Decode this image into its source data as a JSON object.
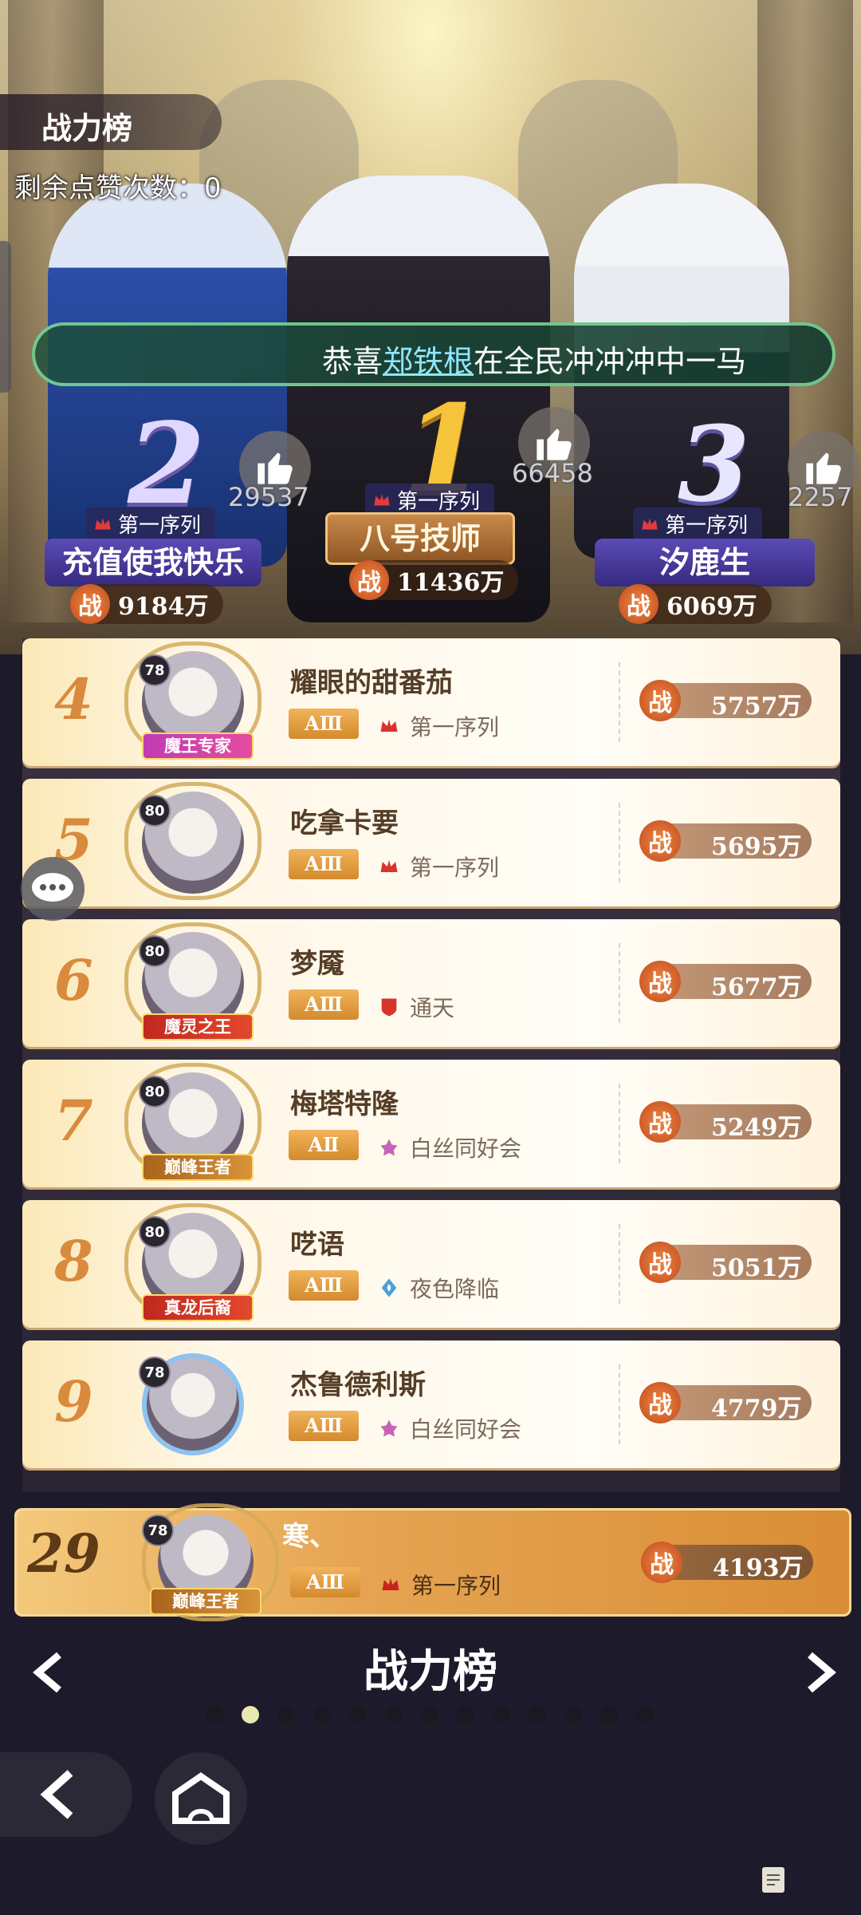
{
  "header": {
    "title": "战力榜",
    "likes_remaining": "剩余点赞次数：0"
  },
  "announcement": {
    "prefix": "恭喜",
    "highlight": "郑铁根",
    "suffix": "在全民冲冲冲中一马"
  },
  "podium": [
    {
      "rank": "1",
      "name": "八号技师",
      "sequence": "第一序列",
      "power": "11436万",
      "likes": "66458"
    },
    {
      "rank": "2",
      "name": "充值使我快乐",
      "sequence": "第一序列",
      "power": "9184万",
      "likes": "29537"
    },
    {
      "rank": "3",
      "name": "汐鹿生",
      "sequence": "第一序列",
      "power": "6069万",
      "likes": "2257"
    }
  ],
  "power_icon_label": "战",
  "list": [
    {
      "rank": "4",
      "level": "78",
      "name": "耀眼的甜番茄",
      "grade": "AⅢ",
      "guild": "第一序列",
      "guild_icon": "crown-icon",
      "power": "5757万",
      "title_tag": "魔王专家"
    },
    {
      "rank": "5",
      "level": "80",
      "name": "吃拿卡要",
      "grade": "AⅢ",
      "guild": "第一序列",
      "guild_icon": "crown-icon",
      "power": "5695万",
      "title_tag": ""
    },
    {
      "rank": "6",
      "level": "80",
      "name": "梦魇",
      "grade": "AⅢ",
      "guild": "通天",
      "guild_icon": "shield-icon",
      "power": "5677万",
      "title_tag": "魔灵之王"
    },
    {
      "rank": "7",
      "level": "80",
      "name": "梅塔特隆",
      "grade": "AⅡ",
      "guild": "白丝同好会",
      "guild_icon": "lotus-icon",
      "power": "5249万",
      "title_tag": "巅峰王者"
    },
    {
      "rank": "8",
      "level": "80",
      "name": "呓语",
      "grade": "AⅢ",
      "guild": "夜色降临",
      "guild_icon": "flame-icon",
      "power": "5051万",
      "title_tag": "真龙后裔"
    },
    {
      "rank": "9",
      "level": "78",
      "name": "杰鲁德利斯",
      "grade": "AⅢ",
      "guild": "白丝同好会",
      "guild_icon": "lotus-icon",
      "power": "4779万",
      "title_tag": ""
    }
  ],
  "me": {
    "rank": "29",
    "level": "78",
    "name": "寒、",
    "grade": "AⅢ",
    "guild": "第一序列",
    "power": "4193万",
    "title_tag": "巅峰王者"
  },
  "footer": {
    "title": "战力榜",
    "page_index": 2,
    "page_count": 13
  },
  "colors": {
    "power_badge": "#e0682a",
    "marquee_border": "#8cf0aa",
    "highlight_name": "#8fe6ff"
  }
}
